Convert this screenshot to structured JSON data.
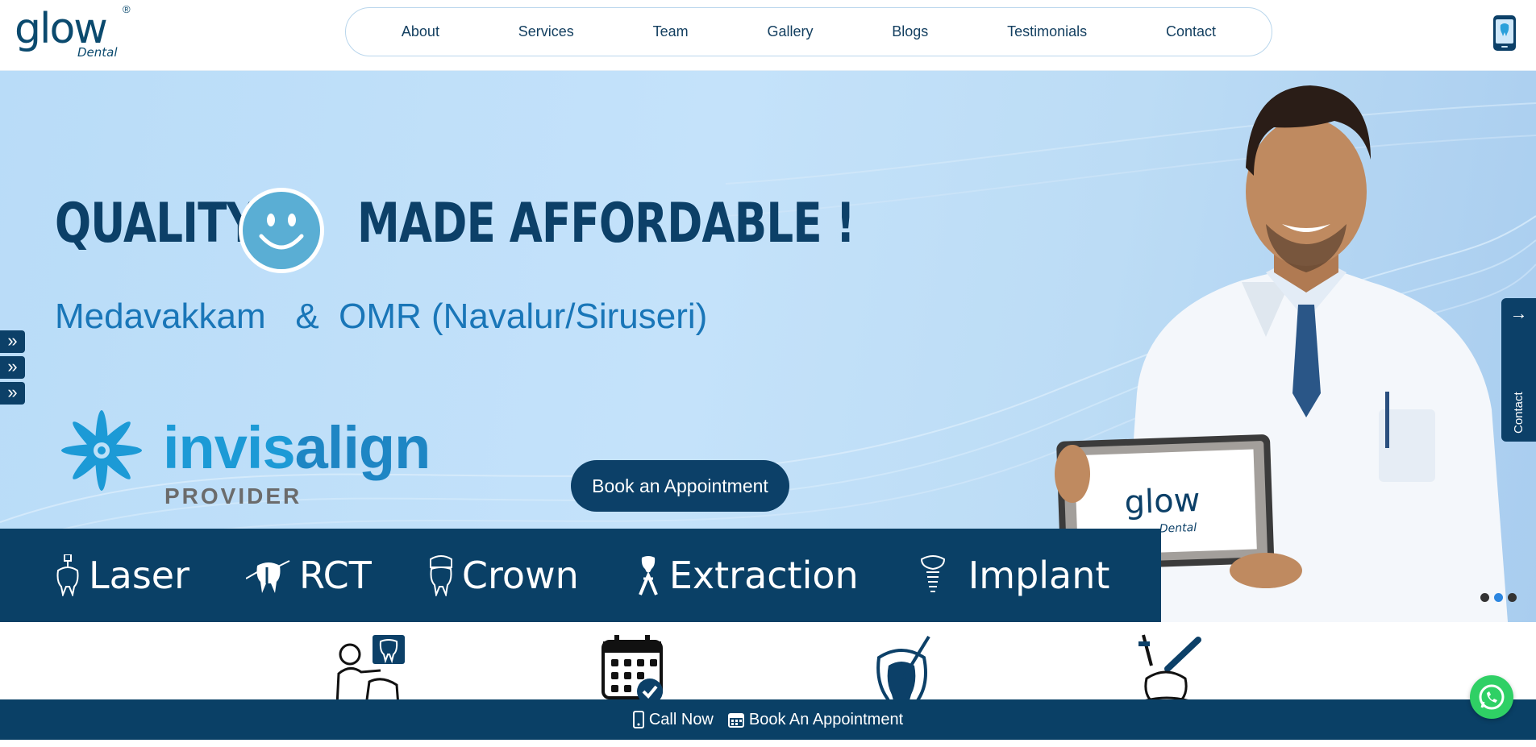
{
  "brand": {
    "logo_word": "glow",
    "logo_sub": "Dental",
    "logo_reg": "®",
    "primary_color": "#0a4066",
    "accent_color": "#1c9ad6"
  },
  "nav": {
    "items": [
      "About",
      "Services",
      "Team",
      "Gallery",
      "Blogs",
      "Testimonials",
      "Contact"
    ],
    "phone_icon": "mobile-phone-icon"
  },
  "hero": {
    "headline_left": "QUALITY",
    "headline_right": "MADE AFFORDABLE !",
    "location": "Medavakkam   &  OMR (Navalur/Siruseri)",
    "invisalign_word_a": "invis",
    "invisalign_word_b": "align",
    "invisalign_provider": "PROVIDER",
    "book_button": "Book an Appointment",
    "tablet_logo_word": "glow",
    "tablet_logo_sub": "Dental",
    "contact_tab_arrow": "→",
    "contact_tab_label": "Contact",
    "slider_active_index": 1,
    "slider_count": 3
  },
  "services": [
    {
      "label": "Laser",
      "icon": "laser-tooth-icon"
    },
    {
      "label": "RCT",
      "icon": "rct-tooth-icon"
    },
    {
      "label": "Crown",
      "icon": "crown-tooth-icon"
    },
    {
      "label": "Extraction",
      "icon": "extraction-tooth-icon"
    },
    {
      "label": "Implant",
      "icon": "implant-tooth-icon"
    }
  ],
  "feature_icons": [
    "dental-xray-icon",
    "calendar-check-icon",
    "tooth-root-canal-icon",
    "tooth-injection-icon"
  ],
  "bottom_bar": {
    "call_now": "Call Now",
    "book": "Book An Appointment"
  }
}
